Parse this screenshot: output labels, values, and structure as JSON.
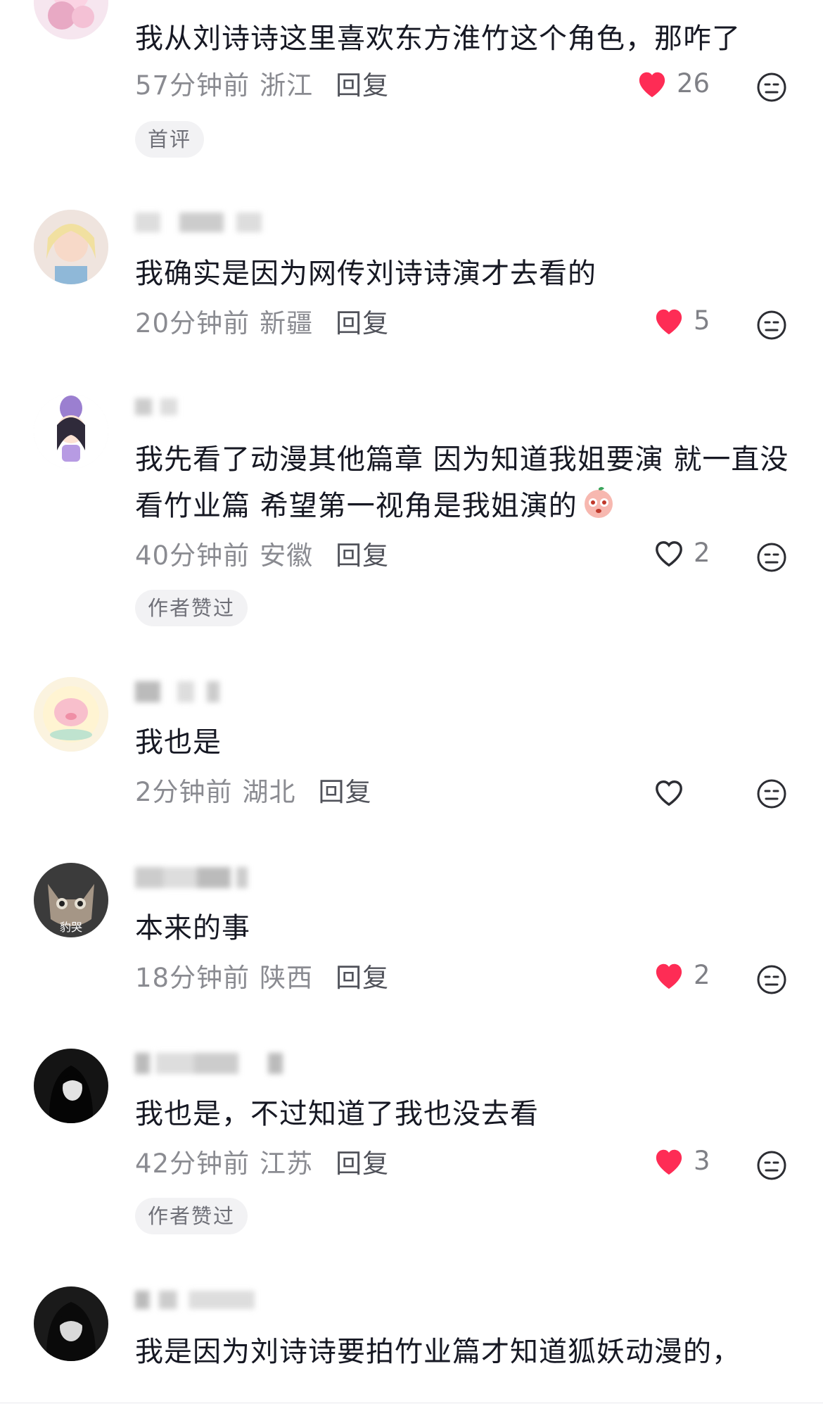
{
  "colors": {
    "like_active": "#fe2c55",
    "text_primary": "#161823",
    "text_secondary": "#8a8b91"
  },
  "comments": [
    {
      "username": "",
      "text": "我从刘诗诗这里喜欢东方淮竹这个角色，那咋了",
      "time": "57分钟前",
      "location": "浙江",
      "reply_label": "回复",
      "likes": "26",
      "liked": true,
      "badge": "首评"
    },
    {
      "username": "",
      "text": "我确实是因为网传刘诗诗演才去看的",
      "time": "20分钟前",
      "location": "新疆",
      "reply_label": "回复",
      "likes": "5",
      "liked": true
    },
    {
      "username": "",
      "text": "我先看了动漫其他篇章 因为知道我姐要演 就一直没看竹业篇 希望第一视角是我姐演的",
      "time": "40分钟前",
      "location": "安徽",
      "reply_label": "回复",
      "likes": "2",
      "liked": false,
      "badge": "作者赞过",
      "emoji": "blush-peach-emoji"
    },
    {
      "username": "",
      "text": "我也是",
      "time": "2分钟前",
      "location": "湖北",
      "reply_label": "回复",
      "likes": "",
      "liked": false
    },
    {
      "username": "",
      "text": "本来的事",
      "time": "18分钟前",
      "location": "陕西",
      "reply_label": "回复",
      "likes": "2",
      "liked": true,
      "avatar_caption": "豹哭"
    },
    {
      "username": "",
      "text": "我也是，不过知道了我也没去看",
      "time": "42分钟前",
      "location": "江苏",
      "reply_label": "回复",
      "likes": "3",
      "liked": true,
      "badge": "作者赞过"
    },
    {
      "username": "",
      "text": "我是因为刘诗诗要拍竹业篇才知道狐妖动漫的，",
      "time": "",
      "location": "",
      "reply_label": "",
      "likes": "",
      "liked": false
    }
  ]
}
